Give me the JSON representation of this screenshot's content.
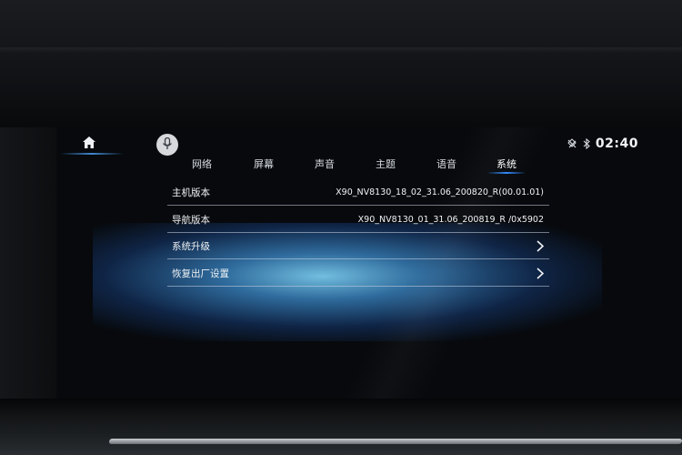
{
  "status_bar": {
    "time": "02:40",
    "icons": [
      "signal-off-icon",
      "bluetooth-icon"
    ]
  },
  "nav": {
    "home_icon": "home-icon",
    "voice_icon": "microphone-icon"
  },
  "tabs": [
    {
      "label": "网络",
      "active": false
    },
    {
      "label": "屏幕",
      "active": false
    },
    {
      "label": "声音",
      "active": false
    },
    {
      "label": "主题",
      "active": false
    },
    {
      "label": "语音",
      "active": false
    },
    {
      "label": "系统",
      "active": true
    }
  ],
  "system": {
    "rows": [
      {
        "label": "主机版本",
        "value": "X90_NV8130_18_02_31.06_200820_R(00.01.01)"
      },
      {
        "label": "导航版本",
        "value": "X90_NV8130_01_31.06_200819_R /0x5902"
      },
      {
        "label": "系统升级",
        "action_icon": "chevron-right-icon"
      },
      {
        "label": "恢复出厂设置",
        "action_icon": "chevron-right-icon"
      }
    ]
  },
  "colors": {
    "accent": "#2f88ff",
    "background": "#07090c",
    "text": "#eef1f5"
  }
}
